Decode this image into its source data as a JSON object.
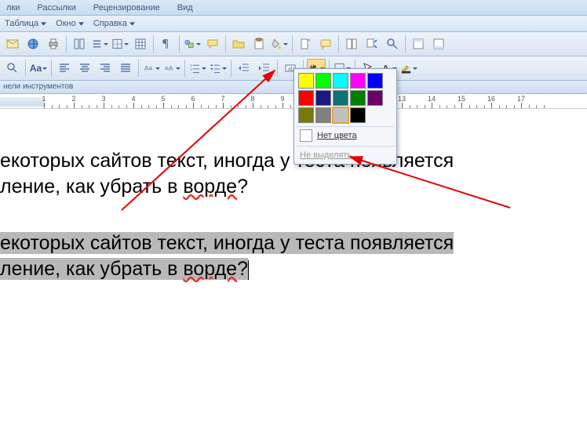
{
  "tabs": {
    "t1": "лки",
    "t2": "Рассылки",
    "t3": "Рецензирование",
    "t4": "Вид"
  },
  "menu": {
    "table": "Таблица",
    "window": "Окно",
    "help": "Справка"
  },
  "panel": {
    "label": "нели инструментов"
  },
  "ruler": {
    "numbers": [
      "1",
      "2",
      "3",
      "4",
      "5",
      "6",
      "7",
      "8",
      "9",
      "10",
      "11",
      "12",
      "13",
      "14",
      "15",
      "16",
      "17"
    ]
  },
  "colorpanel": {
    "swatches": [
      [
        "#ffff00",
        "#00ff00",
        "#00ffff",
        "#ff00ff",
        "#0000ff"
      ],
      [
        "#ff0000",
        "#1a1a80",
        "#0d7373",
        "#008000",
        "#6a006a"
      ],
      [
        "#7a7a0c",
        "#808080",
        "#c0c0c0",
        "#000000",
        null
      ]
    ],
    "selected": [
      2,
      2
    ],
    "noColor": "Нет цвета",
    "noSelect": "Не выделять"
  },
  "text": {
    "l1": "екоторых сайтов текст, иногда у теста появляется",
    "l2a": "ление, как убрать в ",
    "l2b": "ворде",
    "l2c": "?"
  }
}
